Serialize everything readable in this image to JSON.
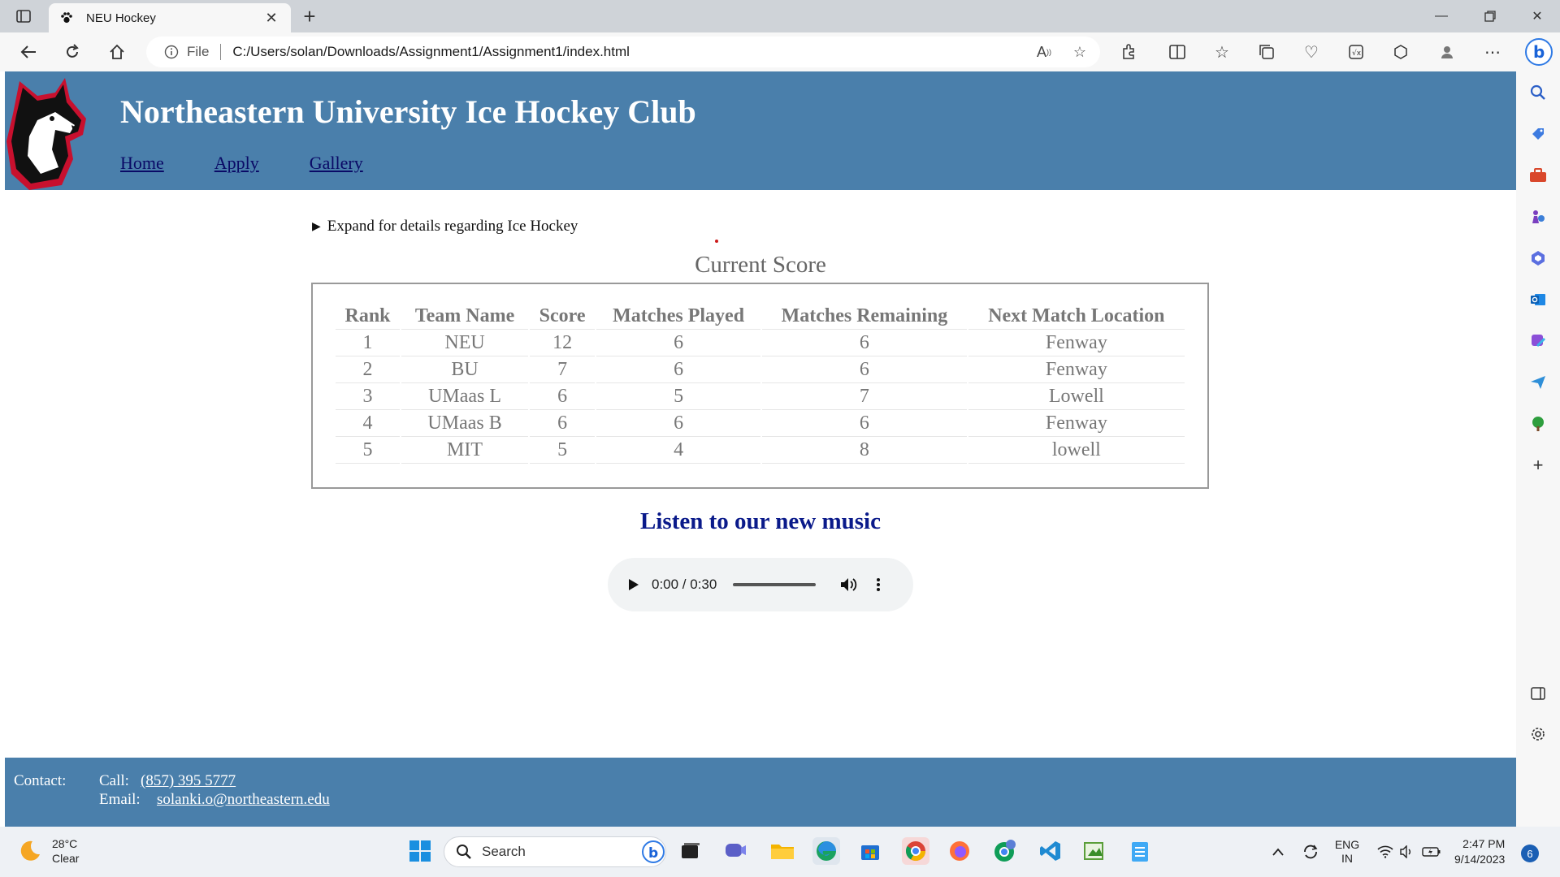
{
  "browser": {
    "tab_title": "NEU Hockey",
    "address_prefix": "File",
    "url": "C:/Users/solan/Downloads/Assignment1/Assignment1/index.html"
  },
  "site": {
    "title": "Northeastern University Ice Hockey Club",
    "nav": [
      {
        "label": "Home"
      },
      {
        "label": "Apply"
      },
      {
        "label": "Gallery"
      }
    ],
    "details_summary": "Expand for details regarding Ice Hockey",
    "score_title": "Current Score",
    "score_table": {
      "headers": [
        "Rank",
        "Team Name",
        "Score",
        "Matches Played",
        "Matches Remaining",
        "Next Match Location"
      ],
      "rows": [
        [
          "1",
          "NEU",
          "12",
          "6",
          "6",
          "Fenway"
        ],
        [
          "2",
          "BU",
          "7",
          "6",
          "6",
          "Fenway"
        ],
        [
          "3",
          "UMaas L",
          "6",
          "5",
          "7",
          "Lowell"
        ],
        [
          "4",
          "UMaas B",
          "6",
          "6",
          "6",
          "Fenway"
        ],
        [
          "5",
          "MIT",
          "5",
          "4",
          "8",
          "lowell"
        ]
      ]
    },
    "music_title": "Listen to our new music",
    "audio": {
      "time": "0:00 / 0:30",
      "progress": 0
    },
    "footer": {
      "contact_label": "Contact:",
      "call_label": "Call:",
      "phone": "(857) 395 5777",
      "email_label": "Email:",
      "email": "solanki.o@northeastern.edu"
    }
  },
  "taskbar": {
    "temperature": "28°C",
    "condition": "Clear",
    "search_placeholder": "Search",
    "language_line1": "ENG",
    "language_line2": "IN",
    "time": "2:47 PM",
    "date": "9/14/2023",
    "notification_count": "6"
  }
}
